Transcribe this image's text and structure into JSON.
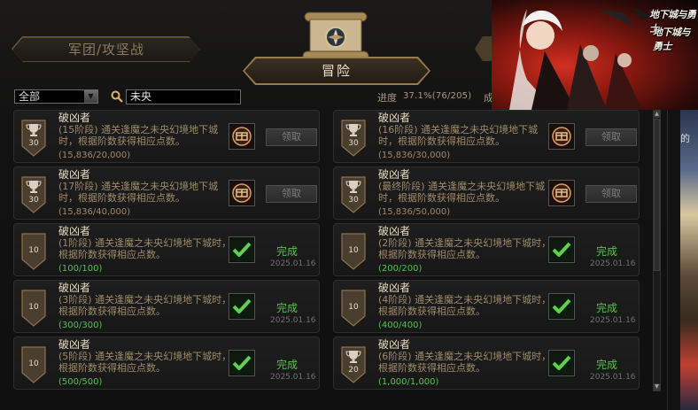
{
  "tabs": {
    "left_tab": "军团/攻坚战",
    "active_tab": "冒险"
  },
  "filter": {
    "category_value": "全部",
    "search_value": "未央"
  },
  "progress": {
    "label": "进度",
    "value": "37.1%(76/205)",
    "fragment": "成"
  },
  "ad": {
    "logo_line1": "地下城与勇士",
    "logo_line2": "地下城与勇士"
  },
  "edge": {
    "text": "的"
  },
  "colors": {
    "done_green": "#4fc44a",
    "gold_text": "#c9b790",
    "border_gold": "#9a7c4c"
  },
  "cards": [
    {
      "title": "破凶者",
      "desc": "(15阶段) 通关逢魔之未央幻境地下城时，根据阶数获得相应点数。",
      "count": "(15,836/20,000)",
      "points": "30",
      "badge_icon": "trophy-icon",
      "status": "pending",
      "button_label": "领取",
      "status_text": "",
      "date": ""
    },
    {
      "title": "破凶者",
      "desc": "(16阶段) 通关逢魔之未央幻境地下城时，根据阶数获得相应点数。",
      "count": "(15,836/30,000)",
      "points": "30",
      "badge_icon": "trophy-icon",
      "status": "pending",
      "button_label": "领取",
      "status_text": "",
      "date": ""
    },
    {
      "title": "破凶者",
      "desc": "(17阶段) 通关逢魔之未央幻境地下城时，根据阶数获得相应点数。",
      "count": "(15,836/40,000)",
      "points": "30",
      "badge_icon": "trophy-icon",
      "status": "pending",
      "button_label": "领取",
      "status_text": "",
      "date": ""
    },
    {
      "title": "破凶者",
      "desc": "(最终阶段) 通关逢魔之未央幻境地下城时，根据阶数获得相应点数。",
      "count": "(15,836/50,000)",
      "points": "30",
      "badge_icon": "trophy-icon",
      "status": "pending",
      "button_label": "领取",
      "status_text": "",
      "date": ""
    },
    {
      "title": "破凶者",
      "desc": "(1阶段) 通关逢魔之未央幻境地下城时，根据阶数获得相应点数。",
      "count": "(100/100)",
      "points": "10",
      "badge_icon": "",
      "status": "done",
      "button_label": "",
      "status_text": "完成",
      "date": "2025.01.16"
    },
    {
      "title": "破凶者",
      "desc": "(2阶段) 通关逢魔之未央幻境地下城时，根据阶数获得相应点数。",
      "count": "(200/200)",
      "points": "10",
      "badge_icon": "",
      "status": "done",
      "button_label": "",
      "status_text": "完成",
      "date": "2025.01.16"
    },
    {
      "title": "破凶者",
      "desc": "(3阶段) 通关逢魔之未央幻境地下城时，根据阶数获得相应点数。",
      "count": "(300/300)",
      "points": "10",
      "badge_icon": "",
      "status": "done",
      "button_label": "",
      "status_text": "完成",
      "date": "2025.01.16"
    },
    {
      "title": "破凶者",
      "desc": "(4阶段) 通关逢魔之未央幻境地下城时，根据阶数获得相应点数。",
      "count": "(400/400)",
      "points": "10",
      "badge_icon": "",
      "status": "done",
      "button_label": "",
      "status_text": "完成",
      "date": "2025.01.16"
    },
    {
      "title": "破凶者",
      "desc": "(5阶段) 通关逢魔之未央幻境地下城时，根据阶数获得相应点数。",
      "count": "(500/500)",
      "points": "10",
      "badge_icon": "",
      "status": "done",
      "button_label": "",
      "status_text": "完成",
      "date": "2025.01.16"
    },
    {
      "title": "破凶者",
      "desc": "(6阶段) 通关逢魔之未央幻境地下城时，根据阶数获得相应点数。",
      "count": "(1,000/1,000)",
      "points": "20",
      "badge_icon": "trophy-icon",
      "status": "done",
      "button_label": "",
      "status_text": "完成",
      "date": "2025.01.16"
    }
  ]
}
